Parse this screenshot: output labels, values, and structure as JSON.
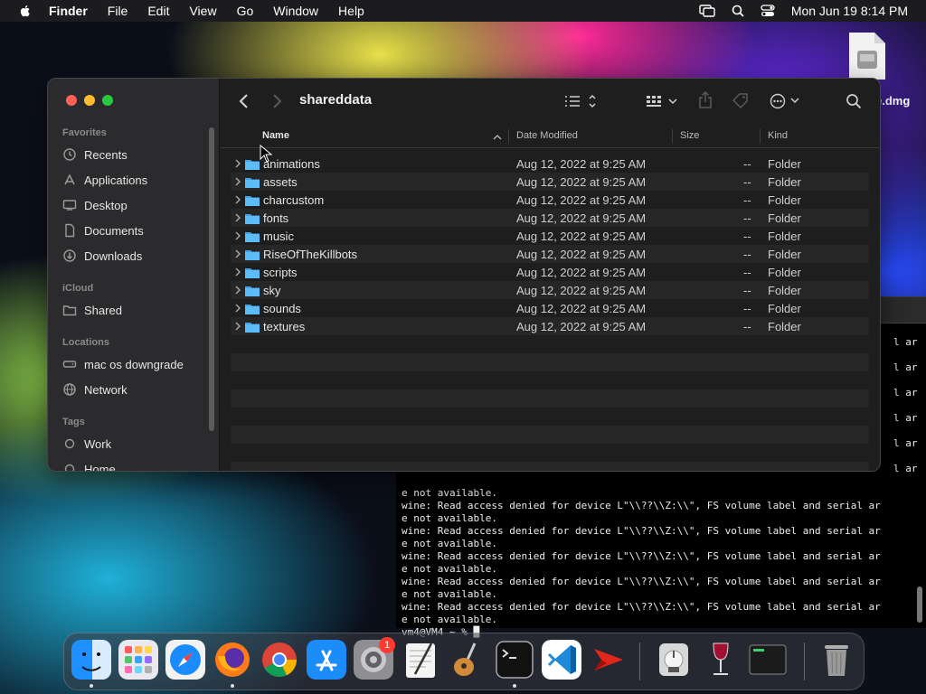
{
  "menubar": {
    "app_name": "Finder",
    "items": [
      "File",
      "Edit",
      "View",
      "Go",
      "Window",
      "Help"
    ],
    "clock": "Mon Jun 19  8:14 PM"
  },
  "desktop": {
    "dmg_label": "e.dmg"
  },
  "terminal": {
    "right_fragments": [
      "l ar",
      "l ar",
      "l ar",
      "l ar",
      "l ar",
      "l ar"
    ],
    "lines": [
      "e not available.",
      "wine: Read access denied for device L\"\\\\??\\\\Z:\\\\\", FS volume label and serial ar",
      "e not available.",
      "wine: Read access denied for device L\"\\\\??\\\\Z:\\\\\", FS volume label and serial ar",
      "e not available.",
      "wine: Read access denied for device L\"\\\\??\\\\Z:\\\\\", FS volume label and serial ar",
      "e not available.",
      "wine: Read access denied for device L\"\\\\??\\\\Z:\\\\\", FS volume label and serial ar",
      "e not available.",
      "wine: Read access denied for device L\"\\\\??\\\\Z:\\\\\", FS volume label and serial ar",
      "e not available.",
      "vm4@VM4 ~ % █"
    ]
  },
  "finder": {
    "title": "shareddata",
    "sidebar": {
      "sections": [
        {
          "heading": "Favorites",
          "items": [
            {
              "label": "Recents",
              "icon": "clock-icon"
            },
            {
              "label": "Applications",
              "icon": "applications-icon"
            },
            {
              "label": "Desktop",
              "icon": "desktop-icon"
            },
            {
              "label": "Documents",
              "icon": "document-icon"
            },
            {
              "label": "Downloads",
              "icon": "download-icon"
            }
          ]
        },
        {
          "heading": "iCloud",
          "items": [
            {
              "label": "Shared",
              "icon": "shared-folder-icon"
            }
          ]
        },
        {
          "heading": "Locations",
          "items": [
            {
              "label": "mac os downgrade",
              "icon": "disk-icon"
            },
            {
              "label": "Network",
              "icon": "network-icon"
            }
          ]
        },
        {
          "heading": "Tags",
          "items": [
            {
              "label": "Work",
              "icon": "tag-circle-icon"
            },
            {
              "label": "Home",
              "icon": "tag-circle-icon"
            }
          ]
        }
      ]
    },
    "columns": {
      "name": "Name",
      "date": "Date Modified",
      "size": "Size",
      "kind": "Kind"
    },
    "files": [
      {
        "name": "animations",
        "date": "Aug 12, 2022 at 9:25 AM",
        "size": "--",
        "kind": "Folder"
      },
      {
        "name": "assets",
        "date": "Aug 12, 2022 at 9:25 AM",
        "size": "--",
        "kind": "Folder"
      },
      {
        "name": "charcustom",
        "date": "Aug 12, 2022 at 9:25 AM",
        "size": "--",
        "kind": "Folder"
      },
      {
        "name": "fonts",
        "date": "Aug 12, 2022 at 9:25 AM",
        "size": "--",
        "kind": "Folder"
      },
      {
        "name": "music",
        "date": "Aug 12, 2022 at 9:25 AM",
        "size": "--",
        "kind": "Folder"
      },
      {
        "name": "RiseOfTheKillbots",
        "date": "Aug 12, 2022 at 9:25 AM",
        "size": "--",
        "kind": "Folder"
      },
      {
        "name": "scripts",
        "date": "Aug 12, 2022 at 9:25 AM",
        "size": "--",
        "kind": "Folder"
      },
      {
        "name": "sky",
        "date": "Aug 12, 2022 at 9:25 AM",
        "size": "--",
        "kind": "Folder"
      },
      {
        "name": "sounds",
        "date": "Aug 12, 2022 at 9:25 AM",
        "size": "--",
        "kind": "Folder"
      },
      {
        "name": "textures",
        "date": "Aug 12, 2022 at 9:25 AM",
        "size": "--",
        "kind": "Folder"
      }
    ]
  },
  "dock": {
    "apps": [
      {
        "name": "finder-icon",
        "color": "#1e90ff"
      },
      {
        "name": "launchpad-icon",
        "color": "#e9e9ef"
      },
      {
        "name": "safari-icon",
        "color": "#1a8cff"
      },
      {
        "name": "firefox-icon",
        "color": "#ff7a18"
      },
      {
        "name": "chrome-icon",
        "color": "#f2f2f2"
      },
      {
        "name": "app-store-icon",
        "color": "#1c8cf8"
      },
      {
        "name": "system-preferences-icon",
        "color": "#8e8e93"
      },
      {
        "name": "textedit-icon",
        "color": "#f4f4f4"
      },
      {
        "name": "garageband-icon",
        "color": "#3b2a1e"
      },
      {
        "name": "terminal-icon",
        "color": "#111111"
      },
      {
        "name": "vscode-icon",
        "color": "#ffffff"
      },
      {
        "name": "cheatsheet-arrow-icon",
        "color": "#1a1a1a"
      },
      {
        "name": "disk-utility-icon",
        "color": "#d8d8d8"
      },
      {
        "name": "wine-icon",
        "color": "#a01030"
      },
      {
        "name": "console-icon",
        "color": "#1b1b1b"
      },
      {
        "name": "trash-icon",
        "color": "#9a9a9a"
      }
    ],
    "badge": "1"
  }
}
